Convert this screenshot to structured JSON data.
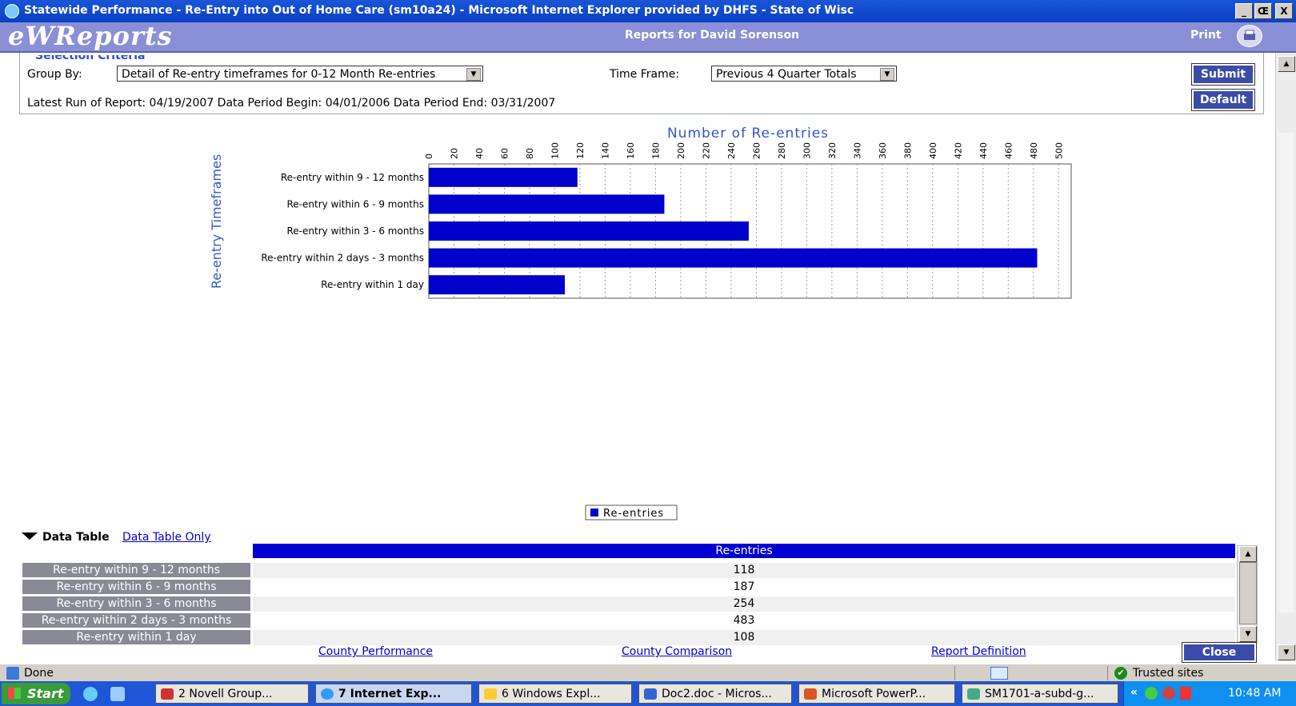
{
  "window": {
    "title": "Statewide Performance - Re-Entry into Out of Home Care (sm10a24) - Microsoft Internet Explorer provided by DHFS - State of Wisc",
    "controls": [
      "_",
      "Œ",
      "X"
    ]
  },
  "header": {
    "logo": "eWReports",
    "user": "Reports for David Sorenson",
    "print_label": "Print"
  },
  "selection": {
    "title": "Selection Criteria",
    "group_by_label": "Group By:",
    "group_by_value": "Detail of Re-entry timeframes for 0-12 Month Re-entries",
    "time_frame_label": "Time Frame:",
    "time_frame_value": "Previous 4 Quarter Totals",
    "submit_label": "Submit",
    "default_label": "Default",
    "run_info": "Latest Run of Report:  04/19/2007   Data Period Begin:  04/01/2006   Data Period End:  03/31/2007"
  },
  "chart_data": {
    "type": "bar",
    "orientation": "horizontal",
    "title": "Number of Re-entries",
    "xlabel": "",
    "ylabel": "Re-entry Timeframes",
    "categories": [
      "Re-entry within 9 - 12 months",
      "Re-entry within 6 - 9 months",
      "Re-entry within 3 - 6 months",
      "Re-entry within 2 days - 3 months",
      "Re-entry within 1 day"
    ],
    "series": [
      {
        "name": "Re-entries",
        "values": [
          118,
          187,
          254,
          483,
          108
        ]
      }
    ],
    "xlim": [
      0,
      510
    ],
    "xticks": [
      "0",
      "20",
      "40",
      "60",
      "80",
      "100",
      "120",
      "140",
      "160",
      "180",
      "200",
      "220",
      "240",
      "260",
      "280",
      "300",
      "320",
      "340",
      "360",
      "380",
      "400",
      "420",
      "440",
      "460",
      "480",
      "500"
    ],
    "grid": true,
    "legend_position": "bottom-center",
    "bar_color": "#0000cc"
  },
  "data_table": {
    "toggle_label": "Data Table",
    "only_link": "Data Table Only",
    "column_header": "Re-entries",
    "rows": [
      {
        "label": "Re-entry within 9 - 12 months",
        "value": "118"
      },
      {
        "label": "Re-entry within 6 - 9 months",
        "value": "187"
      },
      {
        "label": "Re-entry within 3 - 6 months",
        "value": "254"
      },
      {
        "label": "Re-entry within 2 days - 3 months",
        "value": "483"
      },
      {
        "label": "Re-entry within 1 day",
        "value": "108"
      }
    ]
  },
  "footer_links": {
    "county_performance": "County Performance",
    "county_comparison": "County Comparison",
    "report_definition": "Report Definition",
    "close_label": "Close"
  },
  "statusbar": {
    "status": "Done",
    "zone": "Trusted sites"
  },
  "taskbar": {
    "start": "Start",
    "tasks": [
      "2 Novell Group...",
      "7 Internet Exp...",
      "6 Windows Expl...",
      "Doc2.doc - Micros...",
      "Microsoft PowerP...",
      "SM1701-a-subd-g..."
    ],
    "clock": "10:48 AM",
    "tray_chevron": "«"
  }
}
